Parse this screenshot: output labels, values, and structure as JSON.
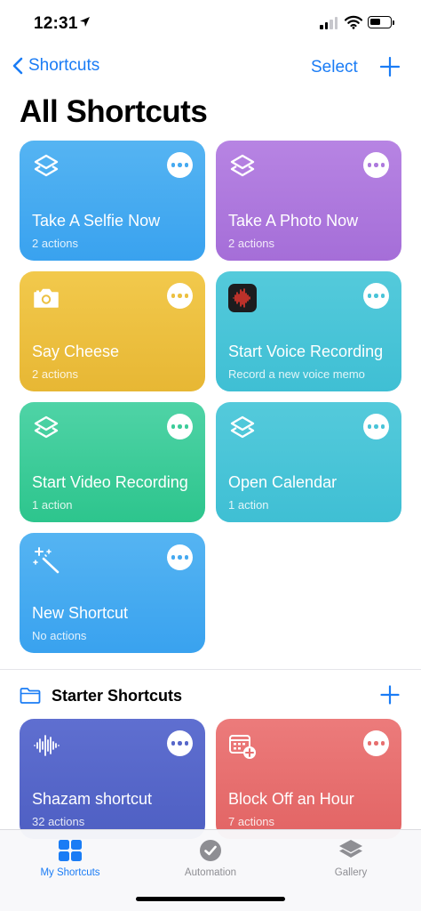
{
  "status_bar": {
    "time": "12:31"
  },
  "nav": {
    "back_label": "Shortcuts",
    "select_label": "Select"
  },
  "page_title": "All Shortcuts",
  "tiles": [
    {
      "name": "Take A Selfie Now",
      "sub": "2 actions",
      "icon": "shortcuts-stack-icon",
      "color": "#45a9f0"
    },
    {
      "name": "Take A Photo Now",
      "sub": "2 actions",
      "icon": "shortcuts-stack-icon",
      "color": "#ad79dd"
    },
    {
      "name": "Say Cheese",
      "sub": "2 actions",
      "icon": "camera-icon",
      "color": "#ecc040"
    },
    {
      "name": "Start Voice Recording",
      "sub": "Record a new voice memo",
      "icon": "voice-memos-app-icon",
      "color": "#49c4d8"
    },
    {
      "name": "Start Video Recording",
      "sub": "1 action",
      "icon": "shortcuts-stack-icon",
      "color": "#3ccc99"
    },
    {
      "name": "Open Calendar",
      "sub": "1 action",
      "icon": "shortcuts-stack-icon",
      "color": "#49c4d8"
    },
    {
      "name": "New Shortcut",
      "sub": "No actions",
      "icon": "magic-wand-icon",
      "color": "#45a9f0"
    }
  ],
  "starter_section": {
    "title": "Starter Shortcuts",
    "tiles": [
      {
        "name": "Shazam shortcut",
        "sub": "32 actions",
        "icon": "waveform-icon",
        "color": "#5767c9"
      },
      {
        "name": "Block Off an Hour",
        "sub": "7 actions",
        "icon": "calendar-add-icon",
        "color": "#e76f6f"
      }
    ]
  },
  "tab_bar": {
    "tabs": [
      {
        "label": "My Shortcuts",
        "icon": "grid-icon",
        "active": true
      },
      {
        "label": "Automation",
        "icon": "clock-check-icon",
        "active": false
      },
      {
        "label": "Gallery",
        "icon": "layers-icon",
        "active": false
      }
    ]
  }
}
